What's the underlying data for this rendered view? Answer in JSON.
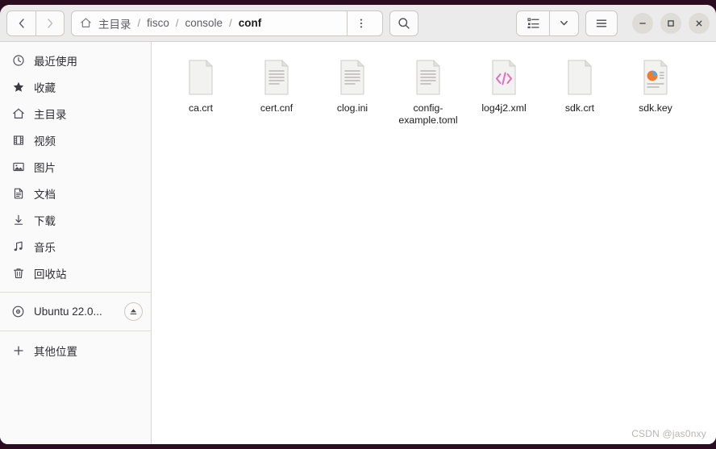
{
  "window": {
    "background_color": "#2a0d20",
    "header_color": "#ebebeb",
    "sidebar_color": "#fafafa",
    "content_color": "#ffffff"
  },
  "header": {
    "nav": {
      "back_label": "‹",
      "forward_label": "›",
      "back_icon": "chevron-left-icon",
      "forward_icon": "chevron-right-icon"
    },
    "breadcrumbs": [
      {
        "label": "主目录",
        "current": false
      },
      {
        "label": "fisco",
        "current": false
      },
      {
        "label": "console",
        "current": false
      },
      {
        "label": "conf",
        "current": true
      }
    ],
    "separator": "/",
    "home_icon": "home-icon",
    "menu_dots_icon": "three-dots-vertical-icon",
    "search_icon": "search-icon",
    "view_list_icon": "list-view-icon",
    "view_dropdown_icon": "chevron-down-icon",
    "main_menu_icon": "hamburger-menu-icon",
    "window_controls": {
      "minimize": "–",
      "maximize": "□",
      "close": "✕"
    }
  },
  "sidebar": {
    "items": [
      {
        "label": "最近使用",
        "icon": "clock-icon"
      },
      {
        "label": "收藏",
        "icon": "star-icon"
      },
      {
        "label": "主目录",
        "icon": "home-icon"
      },
      {
        "label": "视频",
        "icon": "film-icon"
      },
      {
        "label": "图片",
        "icon": "image-icon"
      },
      {
        "label": "文档",
        "icon": "document-icon"
      },
      {
        "label": "下载",
        "icon": "download-icon"
      },
      {
        "label": "音乐",
        "icon": "music-note-icon"
      },
      {
        "label": "回收站",
        "icon": "trash-icon"
      }
    ],
    "devices": [
      {
        "label": "Ubuntu 22.0...",
        "icon": "disc-icon",
        "eject_icon": "eject-icon"
      }
    ],
    "other": {
      "label": "其他位置",
      "icon": "plus-icon"
    }
  },
  "files": [
    {
      "name": "ca.crt",
      "icon": "blank-document-icon"
    },
    {
      "name": "cert.cnf",
      "icon": "text-document-icon"
    },
    {
      "name": "clog.ini",
      "icon": "text-document-icon"
    },
    {
      "name": "config-example.toml",
      "icon": "text-document-icon"
    },
    {
      "name": "log4j2.xml",
      "icon": "xml-code-document-icon"
    },
    {
      "name": "sdk.crt",
      "icon": "blank-document-icon"
    },
    {
      "name": "sdk.key",
      "icon": "presentation-document-icon"
    }
  ],
  "watermark": "CSDN @jas0nxy"
}
